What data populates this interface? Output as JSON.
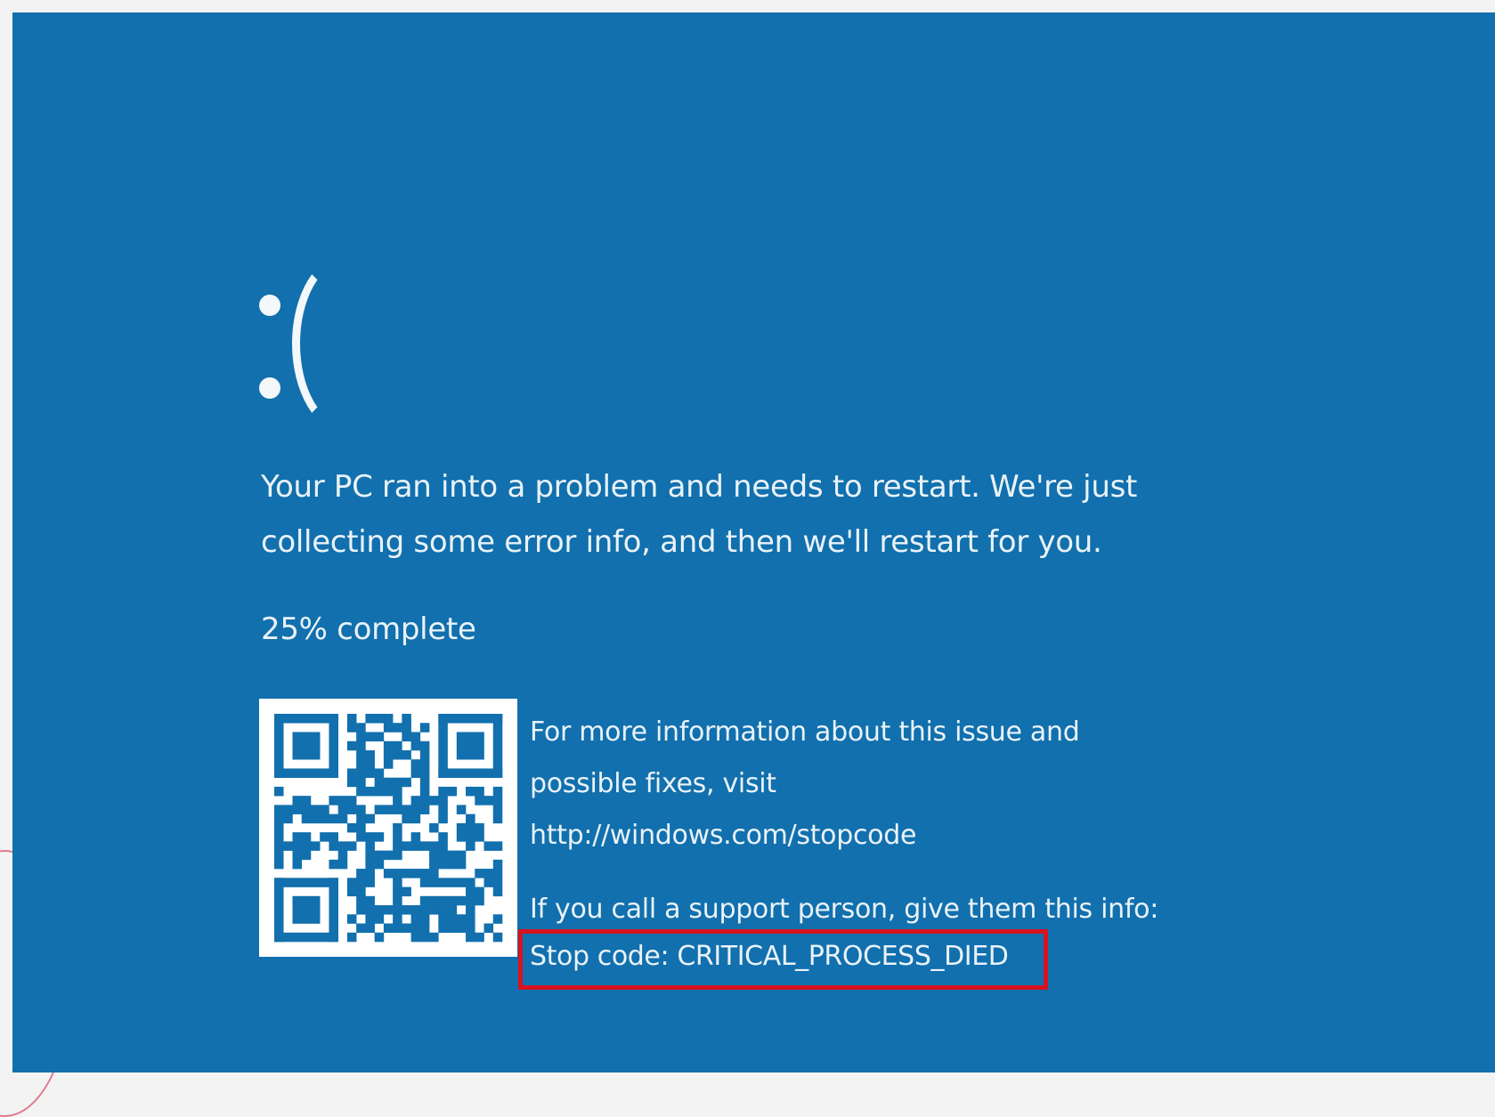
{
  "screen": {
    "background_color": "#1170ad",
    "text_color": "#eaf2f8",
    "highlight_color": "#d8121f",
    "sad_face": ":("
  },
  "message": {
    "line1": "Your PC ran into a problem and needs to restart. We're just",
    "line2": "collecting some error info, and then we'll restart for you."
  },
  "progress": {
    "percent": 25,
    "text": "25% complete"
  },
  "qr": {
    "icon": "qr-code-icon"
  },
  "info": {
    "line1": "For more information about this issue and",
    "line2": "possible fixes, visit",
    "url": "http://windows.com/stopcode",
    "support": "If you call a support person, give them this info:",
    "stop_code": "Stop code: CRITICAL_PROCESS_DIED"
  }
}
